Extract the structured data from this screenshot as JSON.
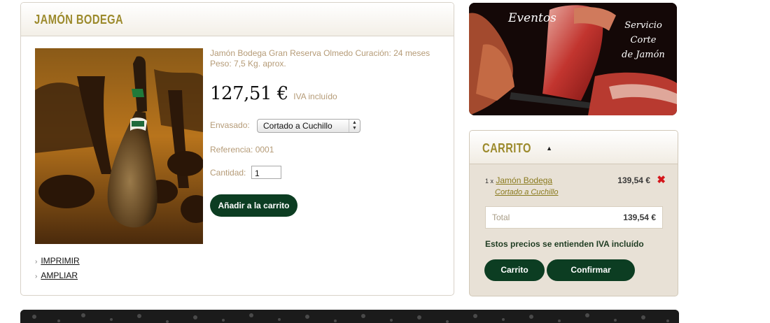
{
  "product": {
    "title": "JAMÓN BODEGA",
    "description_line1": "Jamón Bodega Gran Reserva Olmedo Curación: 24 meses",
    "description_line2": "Peso: 7,5 Kg. aprox.",
    "price": "127,51 €",
    "tax_note": "IVA incluído",
    "packaging_label": "Envasado:",
    "packaging_selected": "Cortado a Cuchillo",
    "reference": "Referencia: 0001",
    "quantity_label": "Cantidad:",
    "quantity_value": "1",
    "add_to_cart_label": "Añadir a la carrito",
    "image_icon": "ham-leg-image"
  },
  "links": {
    "print_label": "IMPRIMIR",
    "enlarge_label": "AMPLIAR"
  },
  "banner": {
    "eventos": "Eventos",
    "servicio_line1": "Servicio",
    "servicio_line2": "Corte",
    "servicio_line3": "de Jamón"
  },
  "cart": {
    "title": "CARRITO",
    "item_qty": "1 x",
    "item_name": "Jamón Bodega",
    "item_variant": "Cortado a Cuchillo",
    "item_price": "139,54 €",
    "total_label": "Total",
    "total_value": "139,54 €",
    "vat_note": "Estos precios se entienden IVA incluído",
    "cart_button": "Carrito",
    "confirm_button": "Confirmar"
  },
  "colors": {
    "accent_olive": "#9c8a2c",
    "button_green": "#0c3d22",
    "muted_text": "#b59b77",
    "remove_red": "#d4161b"
  }
}
